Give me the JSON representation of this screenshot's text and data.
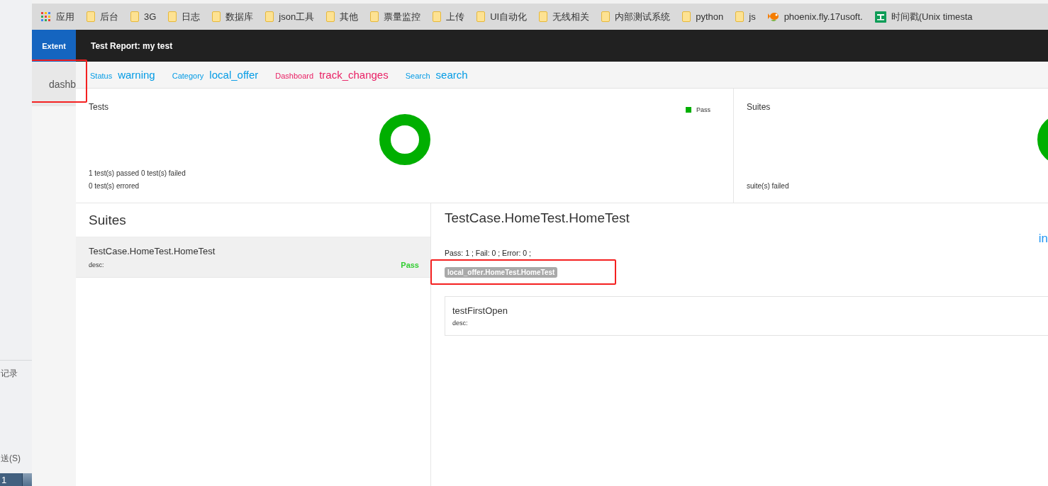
{
  "side_window": {
    "texts": [
      "记录",
      "送(S)"
    ],
    "taskbar_item": "1"
  },
  "bookmarks": [
    {
      "kind": "apps",
      "label": "应用"
    },
    {
      "kind": "folder",
      "label": "后台"
    },
    {
      "kind": "folder",
      "label": "3G"
    },
    {
      "kind": "folder",
      "label": "日志"
    },
    {
      "kind": "folder",
      "label": "数据库"
    },
    {
      "kind": "folder",
      "label": "json工具"
    },
    {
      "kind": "folder",
      "label": "其他"
    },
    {
      "kind": "folder",
      "label": "票量监控"
    },
    {
      "kind": "folder",
      "label": "上传"
    },
    {
      "kind": "folder",
      "label": "UI自动化"
    },
    {
      "kind": "folder",
      "label": "无线相关"
    },
    {
      "kind": "folder",
      "label": "内部测试系统"
    },
    {
      "kind": "folder",
      "label": "python"
    },
    {
      "kind": "folder",
      "label": "js"
    },
    {
      "kind": "site-fish",
      "label": "phoenix.fly.17usoft."
    },
    {
      "kind": "site-sheet",
      "label": "时间戳(Unix timesta"
    }
  ],
  "header": {
    "brand": "Extent",
    "title": "Test Report: my test"
  },
  "sidebar": {
    "items": [
      {
        "label": "dashb",
        "selected": true,
        "marked": true
      }
    ]
  },
  "nav": [
    {
      "label": "Status",
      "icon": "warning",
      "color": "#039be5"
    },
    {
      "label": "Category",
      "icon": "local_offer",
      "color": "#039be5"
    },
    {
      "label": "Dashboard",
      "icon": "track_changes",
      "color": "#e91e63"
    },
    {
      "label": "Search",
      "icon": "search",
      "color": "#039be5"
    }
  ],
  "dashboard": [
    {
      "title": "Tests",
      "legend": [
        {
          "label": "Pass",
          "color": "#00af00"
        }
      ],
      "lines": [
        "1 test(s) passed 0 test(s) failed",
        "0 test(s) errored"
      ]
    },
    {
      "title": "Suites",
      "lines": [
        "suite(s) failed"
      ]
    }
  ],
  "suites": {
    "title": "Suites",
    "items": [
      {
        "name": "TestCase.HomeTest.HomeTest",
        "desc": "desc:",
        "status": "Pass",
        "selected": true
      }
    ]
  },
  "detail": {
    "title": "TestCase.HomeTest.HomeTest",
    "action": "in",
    "summary": "Pass: 1 ; Fail: 0 ; Error: 0 ;",
    "tag": {
      "icon": "local_offer",
      "text": ".HomeTest.HomeTest",
      "marked": true
    },
    "tests": [
      {
        "name": "testFirstOpen",
        "desc": "desc:"
      }
    ]
  }
}
